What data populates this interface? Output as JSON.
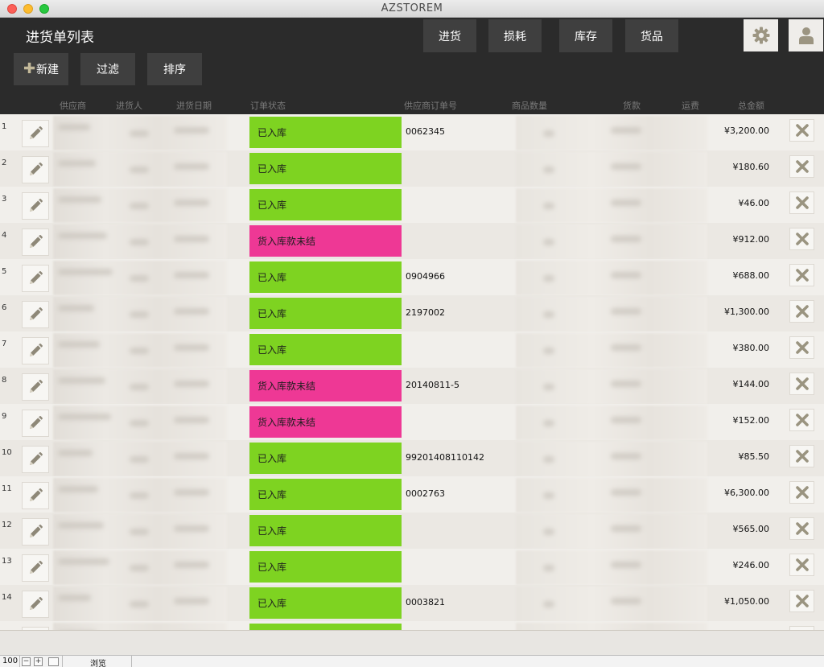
{
  "window": {
    "title": "AZSTOREM"
  },
  "header": {
    "page_title": "进货单列表",
    "toolbar": {
      "new_label": "新建",
      "filter_label": "过滤",
      "sort_label": "排序"
    },
    "nav": {
      "purchase": "进货",
      "loss": "损耗",
      "stock": "库存",
      "goods": "货品"
    },
    "icons": {
      "settings": "gear-icon",
      "user": "user-icon"
    }
  },
  "columns": {
    "supplier": "供应商",
    "purchaser": "进货人",
    "date": "进货日期",
    "status": "订单状态",
    "supplier_order_no": "供应商订单号",
    "quantity": "商品数量",
    "goods_amount": "货款",
    "freight": "运费",
    "total": "总金额"
  },
  "rows": [
    {
      "num": "1",
      "status": "已入库",
      "status_type": "ok",
      "order_no": "0062345",
      "total": "¥3,200.00"
    },
    {
      "num": "2",
      "status": "已入库",
      "status_type": "ok",
      "order_no": "",
      "total": "¥180.60"
    },
    {
      "num": "3",
      "status": "已入库",
      "status_type": "ok",
      "order_no": "",
      "total": "¥46.00"
    },
    {
      "num": "4",
      "status": "货入库款未结",
      "status_type": "pend",
      "order_no": "",
      "total": "¥912.00"
    },
    {
      "num": "5",
      "status": "已入库",
      "status_type": "ok",
      "order_no": "0904966",
      "total": "¥688.00"
    },
    {
      "num": "6",
      "status": "已入库",
      "status_type": "ok",
      "order_no": "2197002",
      "total": "¥1,300.00"
    },
    {
      "num": "7",
      "status": "已入库",
      "status_type": "ok",
      "order_no": "",
      "total": "¥380.00"
    },
    {
      "num": "8",
      "status": "货入库款未结",
      "status_type": "pend",
      "order_no": "20140811-5",
      "total": "¥144.00"
    },
    {
      "num": "9",
      "status": "货入库款未结",
      "status_type": "pend",
      "order_no": "",
      "total": "¥152.00"
    },
    {
      "num": "10",
      "status": "已入库",
      "status_type": "ok",
      "order_no": "99201408110142",
      "total": "¥85.50"
    },
    {
      "num": "11",
      "status": "已入库",
      "status_type": "ok",
      "order_no": "0002763",
      "total": "¥6,300.00"
    },
    {
      "num": "12",
      "status": "已入库",
      "status_type": "ok",
      "order_no": "",
      "total": "¥565.00"
    },
    {
      "num": "13",
      "status": "已入库",
      "status_type": "ok",
      "order_no": "",
      "total": "¥246.00"
    },
    {
      "num": "14",
      "status": "已入库",
      "status_type": "ok",
      "order_no": "0003821",
      "total": "¥1,050.00"
    },
    {
      "num": "",
      "status": "",
      "status_type": "ok",
      "order_no": "",
      "total": ""
    }
  ],
  "colors": {
    "status_ok": "#7ed321",
    "status_pending": "#ee3895",
    "header_bg": "#2b2b2b"
  },
  "statusbar": {
    "zoom": "100",
    "mode": "浏览"
  }
}
